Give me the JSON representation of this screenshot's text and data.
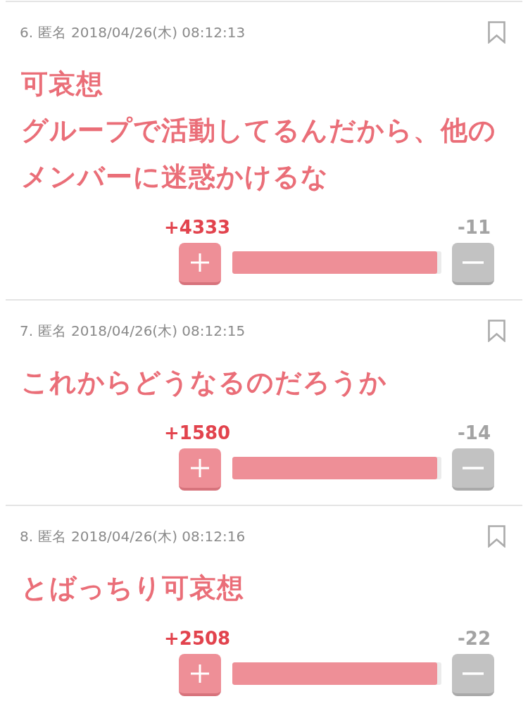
{
  "posts": [
    {
      "number": "6.",
      "author": "匿名",
      "datetime": "2018/04/26(木) 08:12:13",
      "body": [
        "可哀想",
        "グループで活動してるんだから、他のメンバーに迷惑かけるな"
      ],
      "plus": "+4333",
      "minus": "-11",
      "level": 0.98
    },
    {
      "number": "7.",
      "author": "匿名",
      "datetime": "2018/04/26(木) 08:12:15",
      "body": [
        "これからどうなるのだろうか"
      ],
      "plus": "+1580",
      "minus": "-14",
      "level": 0.98
    },
    {
      "number": "8.",
      "author": "匿名",
      "datetime": "2018/04/26(木) 08:12:16",
      "body": [
        "とばっちり可哀想"
      ],
      "plus": "+2508",
      "minus": "-22",
      "level": 0.98
    }
  ]
}
